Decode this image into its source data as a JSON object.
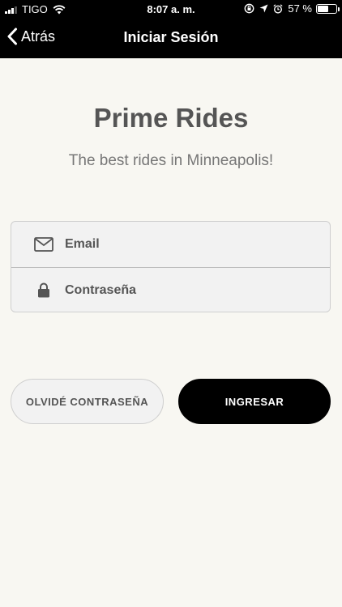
{
  "status_bar": {
    "carrier": "TIGO",
    "time": "8:07 a. m.",
    "battery": "57 %",
    "battery_level": 0.57
  },
  "nav": {
    "back_label": "Atrás",
    "title": "Iniciar Sesión"
  },
  "header": {
    "title": "Prime Rides",
    "subtitle": "The best rides in Minneapolis!"
  },
  "form": {
    "email_placeholder": "Email",
    "email_value": "",
    "password_placeholder": "Contraseña",
    "password_value": ""
  },
  "buttons": {
    "forgot_label": "OLVIDÉ CONTRASEÑA",
    "login_label": "INGRESAR"
  },
  "colors": {
    "background": "#f8f7f2",
    "bar": "#000000",
    "text_dark": "#555555",
    "primary_button": "#000000"
  }
}
